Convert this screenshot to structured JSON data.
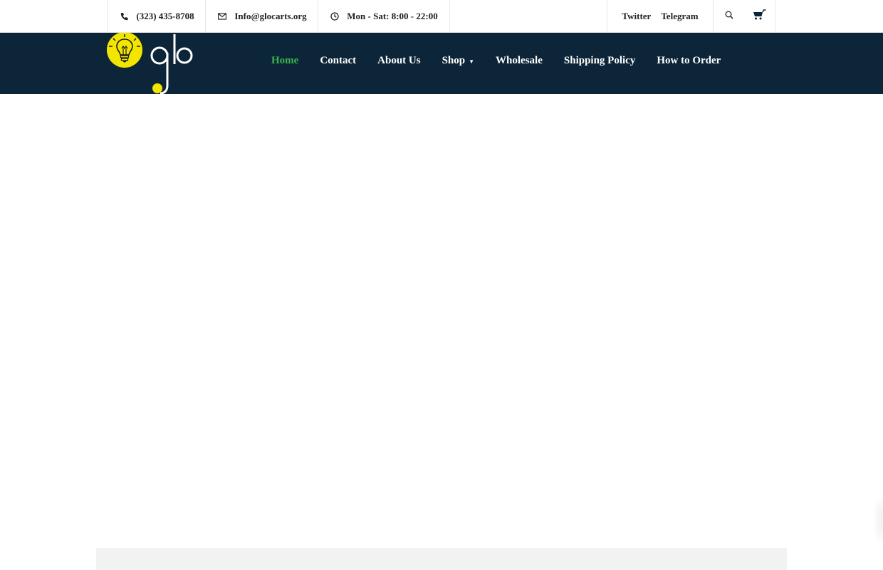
{
  "topbar": {
    "phone": {
      "icon": "phone-icon",
      "text": "(323) 435-8708"
    },
    "email": {
      "icon": "envelope-icon",
      "text": "Info@glocarts.org"
    },
    "hours": {
      "icon": "clock-icon",
      "text": "Mon - Sat: 8:00 - 22:00"
    },
    "social": [
      "Twitter",
      "Telegram"
    ],
    "tools": {
      "search_icon": "search-icon",
      "cart_icon": "cart-icon"
    }
  },
  "nav": {
    "items": [
      {
        "label": "Home",
        "active": true
      },
      {
        "label": "Contact"
      },
      {
        "label": "About Us"
      },
      {
        "label": "Shop",
        "has_dropdown": true
      },
      {
        "label": "Wholesale"
      },
      {
        "label": "Shipping Policy"
      },
      {
        "label": "How to Order"
      }
    ]
  },
  "logo": {
    "text": "glo",
    "icon": "lightbulb-icon"
  },
  "colors": {
    "nav_background": "#0d2538",
    "active_link": "#3bb54a",
    "logo_yellow": "#f2e600",
    "footer_strip": "#f2f2f2"
  }
}
